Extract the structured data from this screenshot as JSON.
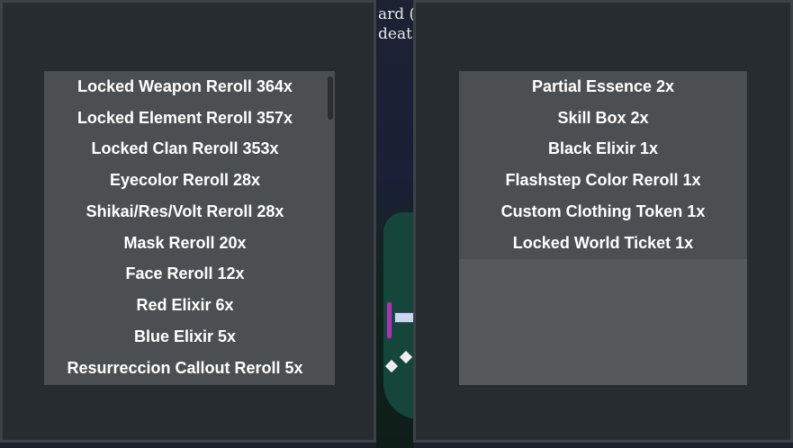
{
  "background": {
    "text_line_1": "ard (",
    "text_line_2": "deat"
  },
  "left_panel": {
    "items": [
      "Locked Weapon Reroll 364x",
      "Locked Element Reroll 357x",
      "Locked Clan Reroll 353x",
      "Eyecolor Reroll 28x",
      "Shikai/Res/Volt Reroll 28x",
      "Mask Reroll 20x",
      "Face Reroll 12x",
      "Red Elixir 6x",
      "Blue Elixir 5x",
      "Resurreccion Callout Reroll 5x"
    ]
  },
  "right_panel": {
    "items": [
      "Partial Essence 2x",
      "Skill Box 2x",
      "Black Elixir 1x",
      "Flashstep Color Reroll 1x",
      "Custom Clothing Token 1x",
      "Locked World Ticket 1x"
    ]
  },
  "colors": {
    "panel_bg": "#262c2f",
    "list_bg": "#4b4f52",
    "text": "#ffffff"
  }
}
